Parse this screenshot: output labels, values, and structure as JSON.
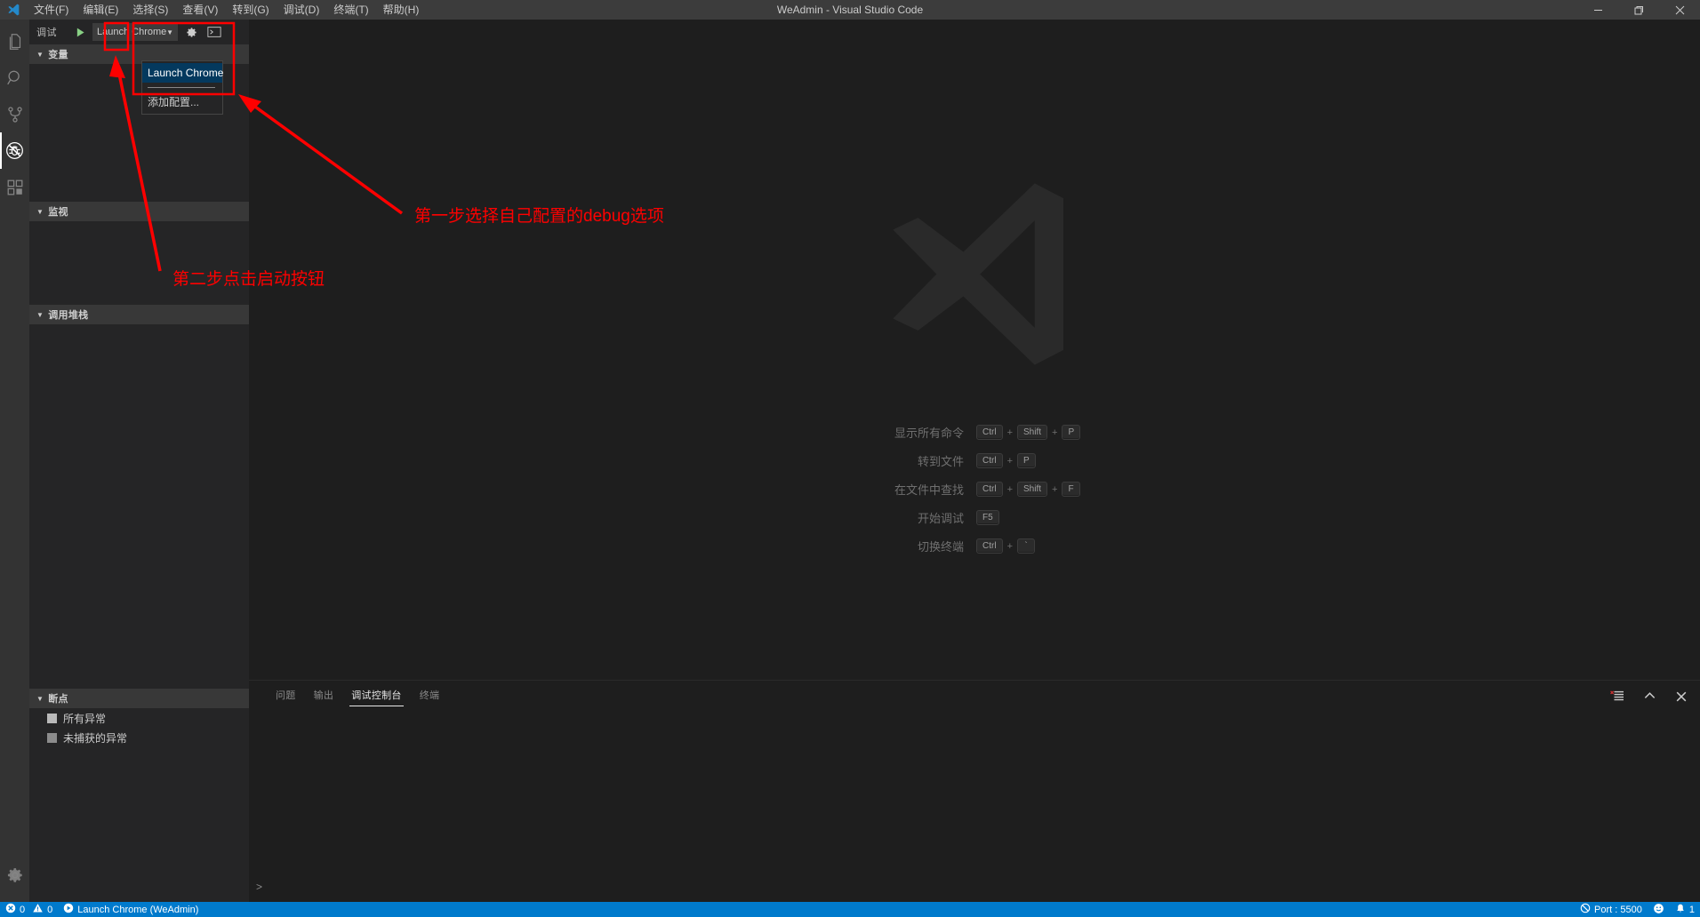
{
  "window": {
    "title": "WeAdmin - Visual Studio Code",
    "controls": {
      "minimize": "minimize-icon",
      "restore": "restore-icon",
      "close": "close-icon"
    }
  },
  "menubar": {
    "items": [
      {
        "label": "文件(F)",
        "name": "menu-file"
      },
      {
        "label": "编辑(E)",
        "name": "menu-edit"
      },
      {
        "label": "选择(S)",
        "name": "menu-selection"
      },
      {
        "label": "查看(V)",
        "name": "menu-view"
      },
      {
        "label": "转到(G)",
        "name": "menu-go"
      },
      {
        "label": "调试(D)",
        "name": "menu-debug"
      },
      {
        "label": "终端(T)",
        "name": "menu-terminal"
      },
      {
        "label": "帮助(H)",
        "name": "menu-help"
      }
    ]
  },
  "activitybar": {
    "items": [
      {
        "icon": "files-explorer-icon",
        "active": false
      },
      {
        "icon": "search-icon",
        "active": false
      },
      {
        "icon": "source-control-icon",
        "active": false
      },
      {
        "icon": "debug-icon",
        "active": true
      },
      {
        "icon": "extensions-icon",
        "active": false
      }
    ],
    "bottom": [
      {
        "icon": "gear-icon",
        "active": false
      }
    ]
  },
  "sidebar": {
    "title": "调试",
    "start_button": "start-debug-icon",
    "configuration": {
      "selected": "Launch Chrome",
      "caret": "▼",
      "open": true,
      "options": [
        {
          "label": "Launch Chrome",
          "selected": true
        },
        {
          "label": "添加配置...",
          "selected": false
        }
      ]
    },
    "gear_icon": "gear-icon",
    "console_icon": "open-debug-console-icon",
    "sections": [
      {
        "title": "变量",
        "name": "section-variables"
      },
      {
        "title": "监视",
        "name": "section-watch"
      },
      {
        "title": "调用堆栈",
        "name": "section-callstack"
      },
      {
        "title": "断点",
        "name": "section-breakpoints"
      }
    ],
    "breakpoints": [
      {
        "label": "所有异常",
        "checked": false
      },
      {
        "label": "未捕获的异常",
        "checked": false
      }
    ]
  },
  "editor": {
    "watermark": "vscode-logo-watermark",
    "shortcuts": [
      {
        "label": "显示所有命令",
        "keys": [
          "Ctrl",
          "Shift",
          "P"
        ]
      },
      {
        "label": "转到文件",
        "keys": [
          "Ctrl",
          "P"
        ]
      },
      {
        "label": "在文件中查找",
        "keys": [
          "Ctrl",
          "Shift",
          "F"
        ]
      },
      {
        "label": "开始调试",
        "keys": [
          "F5"
        ]
      },
      {
        "label": "切换终端",
        "keys": [
          "Ctrl",
          "`"
        ]
      }
    ]
  },
  "panel": {
    "tabs": [
      {
        "label": "问题",
        "active": false
      },
      {
        "label": "输出",
        "active": false
      },
      {
        "label": "调试控制台",
        "active": true
      },
      {
        "label": "终端",
        "active": false
      }
    ],
    "actions": [
      {
        "icon": "clear-console-icon"
      },
      {
        "icon": "maximize-panel-icon"
      },
      {
        "icon": "close-panel-icon"
      }
    ],
    "repl_prompt": ">"
  },
  "statusbar": {
    "left": [
      {
        "name": "problems-status",
        "icon": "error-icon",
        "text": "0",
        "icon2": "warning-icon",
        "text2": "0"
      },
      {
        "name": "debug-target-status",
        "icon": "play-circle-icon",
        "text": "Launch Chrome (WeAdmin)"
      }
    ],
    "right": [
      {
        "name": "live-server-port",
        "icon": "circle-slash-icon",
        "text": "Port : 5500"
      },
      {
        "name": "feedback-smiley",
        "icon": "smiley-icon",
        "text": ""
      },
      {
        "name": "notifications",
        "icon": "bell-icon",
        "text": "1"
      }
    ]
  },
  "annotations": [
    {
      "text": "第一步选择自己配置的debug选项",
      "name": "annotation-step-one"
    },
    {
      "text": "第二步点击启动按钮",
      "name": "annotation-step-two"
    }
  ]
}
